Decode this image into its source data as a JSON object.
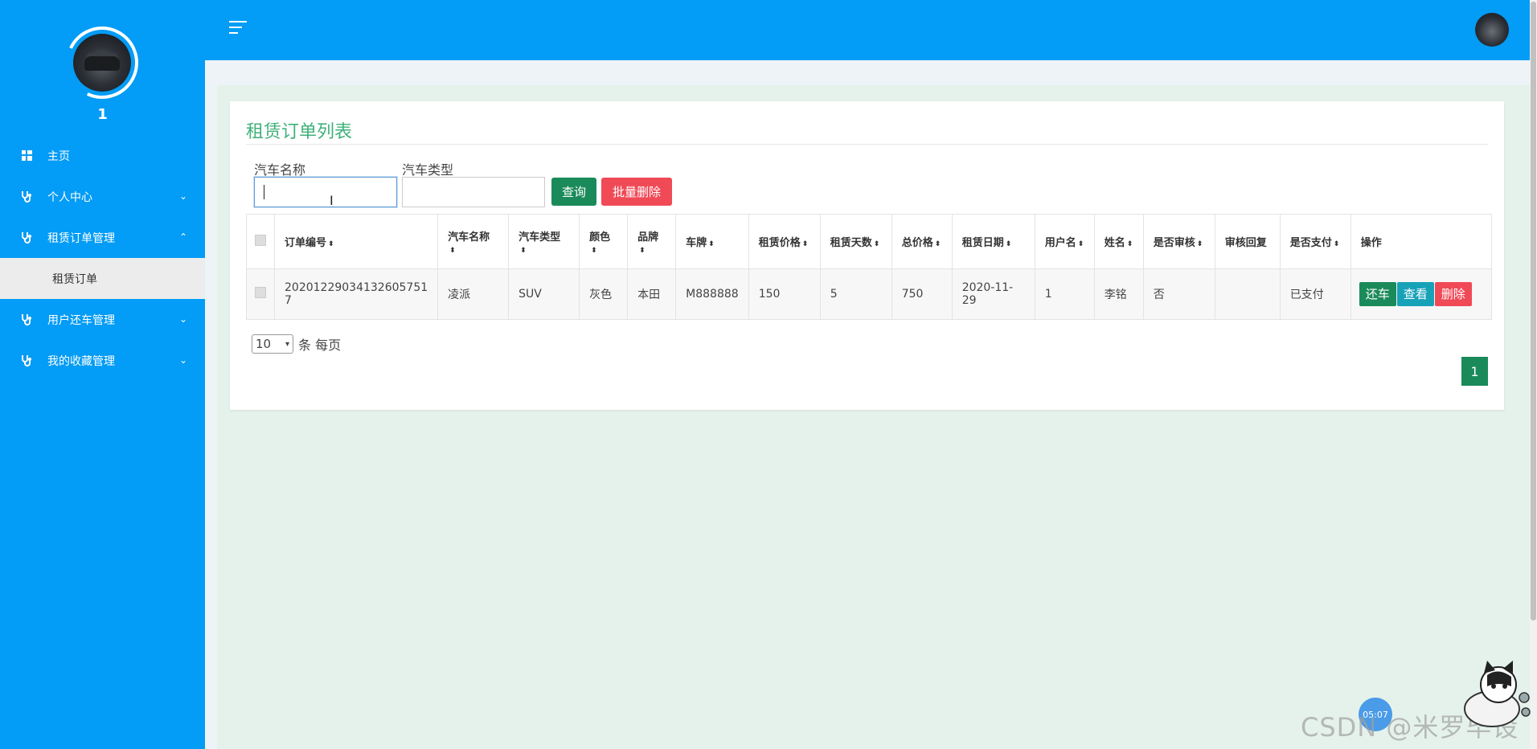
{
  "sidebar": {
    "username": "1",
    "items": [
      {
        "label": "主页",
        "icon": "dashboard-icon"
      },
      {
        "label": "个人中心",
        "icon": "stethoscope-icon",
        "chevron": "down"
      },
      {
        "label": "租赁订单管理",
        "icon": "stethoscope-icon",
        "chevron": "up"
      },
      {
        "label": "用户还车管理",
        "icon": "stethoscope-icon",
        "chevron": "down"
      },
      {
        "label": "我的收藏管理",
        "icon": "stethoscope-icon",
        "chevron": "down"
      }
    ],
    "sub_item": "租赁订单"
  },
  "header": {
    "menu_icon": "hamburger-icon",
    "avatar_icon": "user-avatar"
  },
  "main": {
    "title": "租赁订单列表",
    "filters": {
      "car_name_label": "汽车名称",
      "car_name_value": "",
      "car_type_label": "汽车类型",
      "car_type_value": ""
    },
    "search_label": "查询",
    "batch_delete_label": "批量删除",
    "table": {
      "columns": [
        "订单编号",
        "汽车名称",
        "汽车类型",
        "颜色",
        "品牌",
        "车牌",
        "租赁价格",
        "租赁天数",
        "总价格",
        "租赁日期",
        "用户名",
        "姓名",
        "是否审核",
        "审核回复",
        "是否支付",
        "操作"
      ],
      "rows": [
        {
          "order_no": "20201229034132605751​7",
          "car_name": "凌派",
          "car_type": "SUV",
          "color": "灰色",
          "brand": "本田",
          "plate": "M888888",
          "price": "150",
          "days": "5",
          "total": "750",
          "date": "2020-11-29",
          "username": "1",
          "name": "李铭",
          "audited": "否",
          "reply": "",
          "paid": "已支付",
          "actions": {
            "return": "还车",
            "view": "查看",
            "delete": "删除"
          }
        }
      ]
    },
    "pagination": {
      "page_size": "10",
      "per_page_label": "条 每页",
      "current_page": "1"
    }
  },
  "watermark": "CSDN @米罗毕设",
  "badge": "05:07"
}
